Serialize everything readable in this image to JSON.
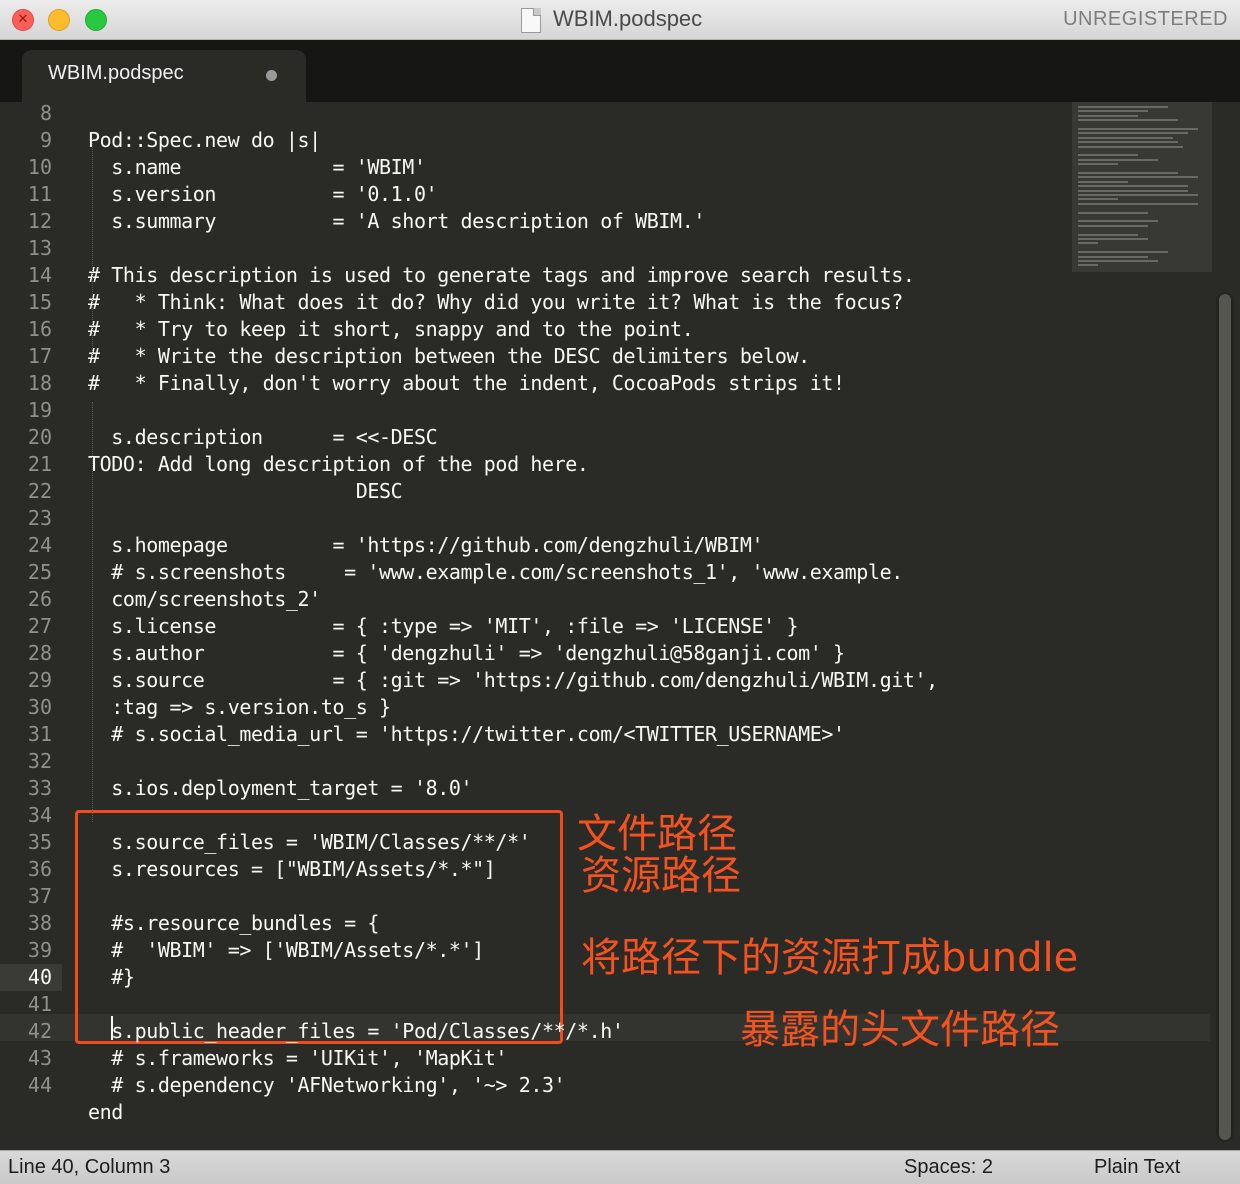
{
  "window": {
    "title": "WBIM.podspec",
    "unregistered": "UNREGISTERED"
  },
  "tab": {
    "label": "WBIM.podspec"
  },
  "colors": {
    "editor_bg": "#2a2b27",
    "annotation": "#f4521e"
  },
  "editor": {
    "gutter": [
      {
        "n": "8"
      },
      {
        "n": "9"
      },
      {
        "n": "10"
      },
      {
        "n": "11"
      },
      {
        "n": "12"
      },
      {
        "n": "13"
      },
      {
        "n": "14"
      },
      {
        "n": "15"
      },
      {
        "n": "16"
      },
      {
        "n": "17"
      },
      {
        "n": "18"
      },
      {
        "n": "19"
      },
      {
        "n": "20"
      },
      {
        "n": "21"
      },
      {
        "n": "22"
      },
      {
        "n": "23"
      },
      {
        "n": "24"
      },
      {
        "n": "25"
      },
      {
        "n": "26"
      },
      {
        "n": "27"
      },
      {
        "n": "28"
      },
      {
        "n": "29"
      },
      {
        "n": "30"
      },
      {
        "n": "31"
      },
      {
        "n": "32"
      },
      {
        "n": "33"
      },
      {
        "n": "34"
      },
      {
        "n": "35"
      },
      {
        "n": "36"
      },
      {
        "n": "37"
      },
      {
        "n": "38"
      },
      {
        "n": "39"
      },
      {
        "n": "40"
      },
      {
        "n": "41"
      },
      {
        "n": "42"
      },
      {
        "n": "43"
      },
      {
        "n": "44"
      }
    ],
    "current_line": "40",
    "code": [
      "Pod::Spec.new do |s|",
      "  s.name             = 'WBIM'",
      "  s.version          = '0.1.0'",
      "  s.summary          = 'A short description of WBIM.'",
      "",
      "# This description is used to generate tags and improve search results.",
      "#   * Think: What does it do? Why did you write it? What is the focus?",
      "#   * Try to keep it short, snappy and to the point.",
      "#   * Write the description between the DESC delimiters below.",
      "#   * Finally, don't worry about the indent, CocoaPods strips it!",
      "",
      "  s.description      = <<-DESC",
      "TODO: Add long description of the pod here.",
      "                       DESC",
      "",
      "  s.homepage         = 'https://github.com/dengzhuli/WBIM'",
      "  # s.screenshots     = 'www.example.com/screenshots_1', 'www.example.",
      "  com/screenshots_2'",
      "  s.license          = { :type => 'MIT', :file => 'LICENSE' }",
      "  s.author           = { 'dengzhuli' => 'dengzhuli@58ganji.com' }",
      "  s.source           = { :git => 'https://github.com/dengzhuli/WBIM.git',",
      "  :tag => s.version.to_s }",
      "  # s.social_media_url = 'https://twitter.com/<TWITTER_USERNAME>'",
      "",
      "  s.ios.deployment_target = '8.0'",
      "",
      "  s.source_files = 'WBIM/Classes/**/*'",
      "  s.resources = [\"WBIM/Assets/*.*\"]",
      "",
      "  #s.resource_bundles = {",
      "  #  'WBIM' => ['WBIM/Assets/*.*']",
      "  #}",
      "",
      "  s.public_header_files = 'Pod/Classes/**/*.h'",
      "  # s.frameworks = 'UIKit', 'MapKit'",
      "  # s.dependency 'AFNetworking', '~> 2.3'",
      "end",
      ""
    ]
  },
  "annotations": {
    "source_path": "文件路径",
    "resource_path": "资源路径",
    "bundle_note": "将路径下的资源打成bundle",
    "header_note": "暴露的头文件路径"
  },
  "status": {
    "position": "Line 40, Column 3",
    "spaces": "Spaces: 2",
    "syntax": "Plain Text"
  }
}
